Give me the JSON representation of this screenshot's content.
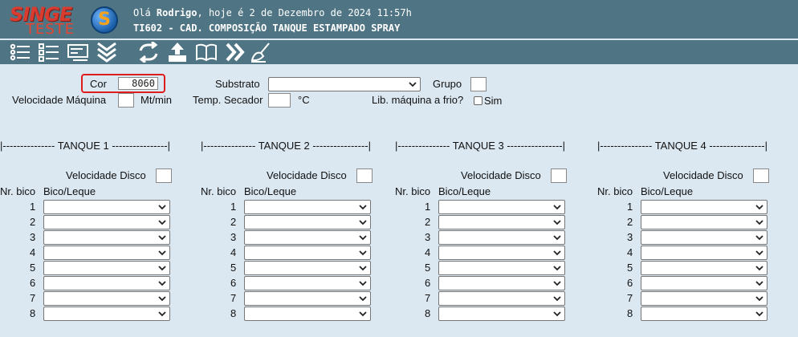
{
  "header": {
    "logo_top": "SINGE",
    "logo_bottom": "TESTE",
    "greeting_prefix": "Olá",
    "user_name": "Rodrigo",
    "greeting_suffix": ", hoje é 2 de Dezembro de 2024 11:57h",
    "screen_title": "TI602 - CAD. COMPOSIÇÃO TANQUE ESTAMPADO SPRAY"
  },
  "toolbar": {
    "icons": [
      "list-icon",
      "checklist-icon",
      "card-icon",
      "chevrons-down-icon",
      "refresh-icon",
      "upload-icon",
      "book-icon",
      "fast-forward-icon",
      "broom-icon"
    ]
  },
  "form": {
    "cor_label": "Cor",
    "cor_value": "8060",
    "substrato_label": "Substrato",
    "substrato_value": "",
    "grupo_label": "Grupo",
    "velocidade_maquina_label": "Velocidade Máquina",
    "velocidade_maquina_unit": "Mt/min",
    "temp_secador_label": "Temp. Secador",
    "temp_secador_unit": "°C",
    "lib_maquina_label": "Lib. máquina a frio?",
    "lib_maquina_option": "Sim",
    "lib_maquina_checked": false
  },
  "tanks": [
    {
      "title": "|--------------- TANQUE 1 ----------------|",
      "velocidade_label": "Velocidade Disco",
      "nr_bico_label": "Nr. bico",
      "bico_leque_label": "Bico/Leque",
      "rows": [
        "1",
        "2",
        "3",
        "4",
        "5",
        "6",
        "7",
        "8"
      ]
    },
    {
      "title": "|--------------- TANQUE 2 ----------------|",
      "velocidade_label": "Velocidade Disco",
      "nr_bico_label": "Nr. bico",
      "bico_leque_label": "Bico/Leque",
      "rows": [
        "1",
        "2",
        "3",
        "4",
        "5",
        "6",
        "7",
        "8"
      ]
    },
    {
      "title": "|--------------- TANQUE 3 ----------------|",
      "velocidade_label": "Velocidade Disco",
      "nr_bico_label": "Nr. bico",
      "bico_leque_label": "Bico/Leque",
      "rows": [
        "1",
        "2",
        "3",
        "4",
        "5",
        "6",
        "7",
        "8"
      ]
    },
    {
      "title": "|--------------- TANQUE 4 ----------------|",
      "velocidade_label": "Velocidade Disco",
      "nr_bico_label": "Nr. bico",
      "bico_leque_label": "Bico/Leque",
      "rows": [
        "1",
        "2",
        "3",
        "4",
        "5",
        "6",
        "7",
        "8"
      ]
    }
  ],
  "colors": {
    "header_bg": "#4f7483",
    "page_bg": "#dbe8f2",
    "highlight": "#e01b1b",
    "logo_red": "#d93b2f"
  }
}
